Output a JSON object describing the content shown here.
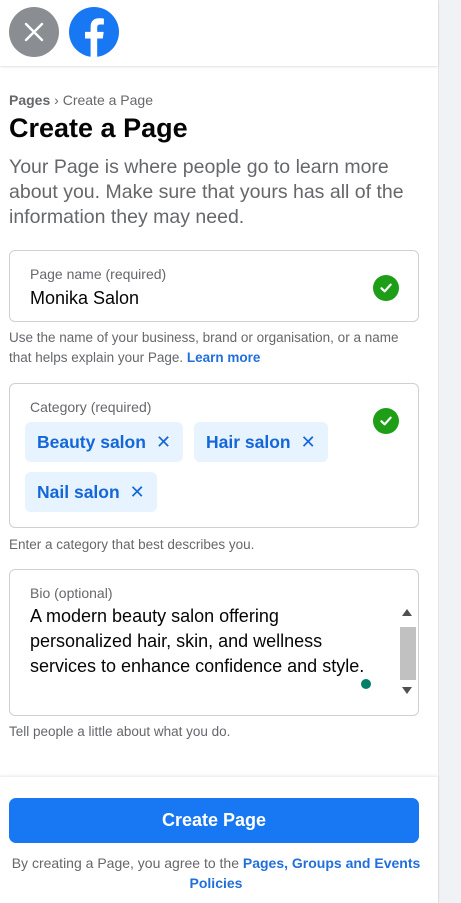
{
  "colors": {
    "accent": "#1877f2",
    "link": "#216fdb",
    "success": "#1e9e16",
    "chip_bg": "#e7f3ff",
    "muted_text": "#65676b"
  },
  "topbar": {
    "close_icon": "close-icon",
    "logo_icon": "facebook-logo-icon"
  },
  "breadcrumb": {
    "root": "Pages",
    "separator": "›",
    "current": "Create a Page"
  },
  "title": "Create a Page",
  "description": "Your Page is where people go to learn more about you. Make sure that yours has all of the information they may need.",
  "page_name": {
    "label": "Page name (required)",
    "value": "Monika Salon",
    "helper": "Use the name of your business, brand or organisation, or a name that helps explain your Page.",
    "helper_link": "Learn more"
  },
  "category": {
    "label": "Category (required)",
    "chips": [
      "Beauty salon",
      "Hair salon",
      "Nail salon"
    ],
    "remove_symbol": "✕",
    "helper": "Enter a category that best describes you."
  },
  "bio": {
    "label": "Bio (optional)",
    "value": "A modern beauty salon offering personalized hair, skin, and wellness services to enhance confidence and style.",
    "helper": "Tell people a little about what you do."
  },
  "footer": {
    "button_label": "Create Page",
    "terms_text": "By creating a Page, you agree to the",
    "terms_link": "Pages, Groups and Events Policies"
  }
}
